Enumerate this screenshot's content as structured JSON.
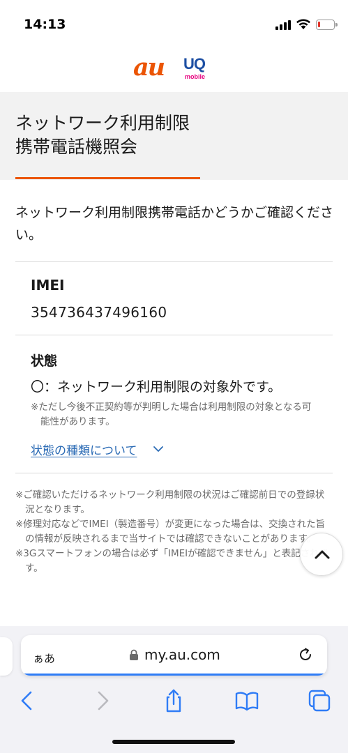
{
  "status_bar": {
    "time": "14:13",
    "battery_level": 0.1,
    "battery_color": "#e2342a"
  },
  "brand": {
    "au_logo": "au",
    "uq_logo": "UQ",
    "uq_sub": "mobile",
    "accent_color": "#eb5505"
  },
  "page": {
    "title_line1": "ネットワーク利用制限",
    "title_line2": "携帯電話機照会",
    "intro": "ネットワーク利用制限携帯電話かどうかご確認ください。"
  },
  "result": {
    "imei_label": "IMEI",
    "imei_value": "354736437496160",
    "status_label": "状態",
    "status_value": "〇：ネットワーク利用制限の対象外です。",
    "status_note": "※ただし今後不正契約等が判明した場合は利用制限の対象となる可能性があります。",
    "status_types_link": "状態の種類について"
  },
  "notes": [
    "※ご確認いただけるネットワーク利用制限の状況はご確認前日での登録状況となります。",
    "※修理対応などでIMEI（製造番号）が変更になった場合は、交換された旨の情報が反映されるまで当サイトでは確認できないことがあります。",
    "※3Gスマートフォンの場合は必ず「IMEIが確認できません」と表記されます。"
  ],
  "browser": {
    "text_size_button": "ぁあ",
    "url": "my.au.com",
    "icons": [
      "back-icon",
      "forward-icon",
      "share-icon",
      "bookmarks-icon",
      "tabs-icon",
      "reload-icon",
      "lock-icon"
    ],
    "accent_color": "#2f7cf6"
  }
}
